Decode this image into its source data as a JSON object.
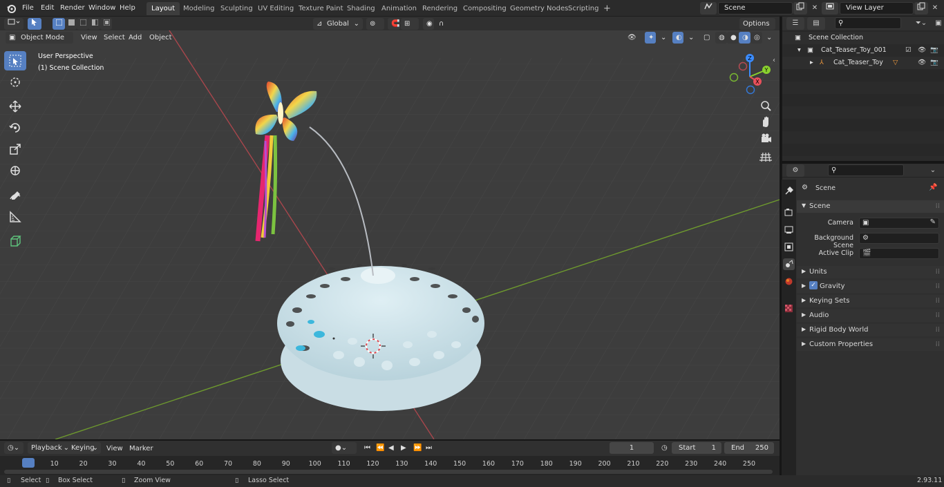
{
  "menu": {
    "items": [
      "File",
      "Edit",
      "Render",
      "Window",
      "Help"
    ]
  },
  "workspaces": {
    "tabs": [
      "Layout",
      "Modeling",
      "Sculpting",
      "UV Editing",
      "Texture Paint",
      "Shading",
      "Animation",
      "Rendering",
      "Compositing",
      "Geometry Nodes",
      "Scripting"
    ],
    "active": "Layout",
    "add_label": "+"
  },
  "scene_selector": {
    "value": "Scene"
  },
  "view_layer_selector": {
    "value": "View Layer"
  },
  "viewport_header": {
    "mode": "Object Mode",
    "menus": [
      "View",
      "Select",
      "Add",
      "Object"
    ],
    "transform_orientation": "Global",
    "options_label": "Options"
  },
  "viewport": {
    "perspective_label": "User Perspective",
    "collection_label": "(1) Scene Collection",
    "gizmo_axes": {
      "x": "X",
      "y": "Y",
      "z": "Z"
    }
  },
  "outliner": {
    "search_placeholder": "",
    "rows": [
      {
        "label": "Scene Collection",
        "indent": 0
      },
      {
        "label": "Cat_Teaser_Toy_001",
        "indent": 1
      },
      {
        "label": "Cat_Teaser_Toy",
        "indent": 2
      }
    ]
  },
  "properties": {
    "breadcrumb": "Scene",
    "panel_title": "Scene",
    "fields": [
      {
        "label": "Camera",
        "value": ""
      },
      {
        "label": "Background Scene",
        "value": ""
      },
      {
        "label": "Active Clip",
        "value": ""
      }
    ],
    "sections": [
      "Units",
      "Gravity",
      "Keying Sets",
      "Audio",
      "Rigid Body World",
      "Custom Properties"
    ],
    "gravity_checked": true
  },
  "timeline": {
    "menus": [
      "Playback",
      "Keying",
      "View",
      "Marker"
    ],
    "current_frame": "1",
    "start_label": "Start",
    "start_value": "1",
    "end_label": "End",
    "end_value": "250",
    "ticks": [
      "1",
      "10",
      "20",
      "30",
      "40",
      "50",
      "60",
      "70",
      "80",
      "90",
      "100",
      "110",
      "120",
      "130",
      "140",
      "150",
      "160",
      "170",
      "180",
      "190",
      "200",
      "210",
      "220",
      "230",
      "240",
      "250"
    ]
  },
  "statusbar": {
    "select": "Select",
    "box_select": "Box Select",
    "zoom_view": "Zoom View",
    "lasso_select": "Lasso Select",
    "version": "2.93.11"
  },
  "colors": {
    "accent": "#5680c2",
    "x_axis": "#e8505b",
    "y_axis": "#8ad12e",
    "z_axis": "#3b8cff",
    "viewport_bg": "#3d3d3d"
  }
}
